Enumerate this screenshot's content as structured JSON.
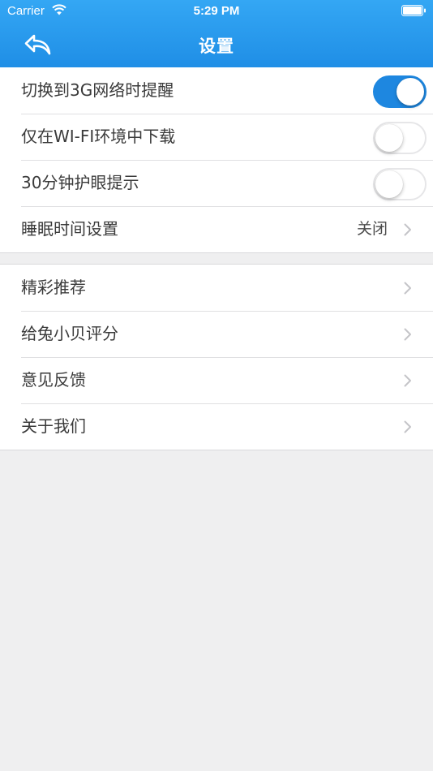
{
  "status_bar": {
    "carrier": "Carrier",
    "time": "5:29 PM"
  },
  "nav": {
    "title": "设置",
    "back_icon": "back-arrow-icon"
  },
  "colors": {
    "header_top": "#34a7f4",
    "header_bottom": "#1f8ee6",
    "toggle_on": "#1e87e0",
    "background": "#efeff0"
  },
  "settings": {
    "group1": [
      {
        "label": "切换到3G网络时提醒",
        "toggle": true
      },
      {
        "label": "仅在WI-FI环境中下载",
        "toggle": false
      },
      {
        "label": "30分钟护眼提示",
        "toggle": false
      },
      {
        "label": "睡眠时间设置",
        "value": "关闭"
      }
    ],
    "group2": [
      {
        "label": "精彩推荐"
      },
      {
        "label": "给兔小贝评分"
      },
      {
        "label": "意见反馈"
      },
      {
        "label": "关于我们"
      }
    ]
  }
}
